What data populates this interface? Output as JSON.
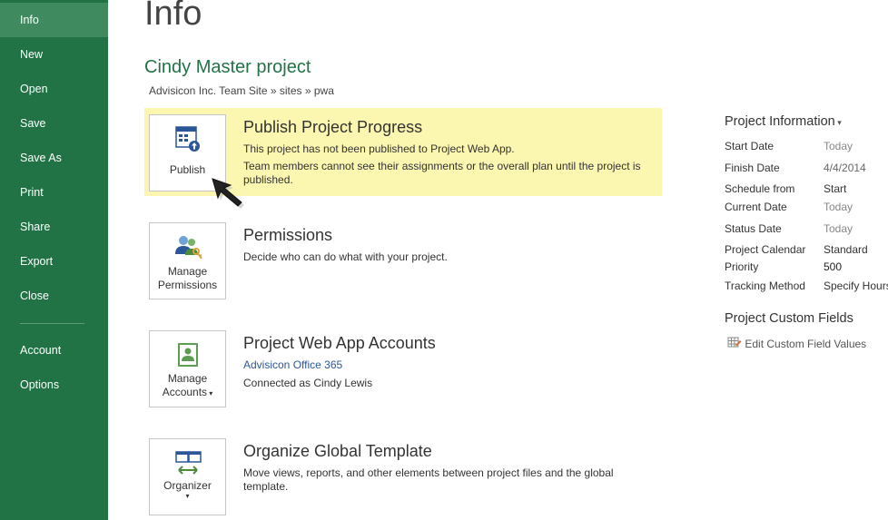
{
  "sidebar": {
    "items": [
      {
        "label": "Info",
        "active": true
      },
      {
        "label": "New"
      },
      {
        "label": "Open"
      },
      {
        "label": "Save"
      },
      {
        "label": "Save As"
      },
      {
        "label": "Print"
      },
      {
        "label": "Share"
      },
      {
        "label": "Export"
      },
      {
        "label": "Close"
      },
      {
        "label": "Account"
      },
      {
        "label": "Options"
      }
    ],
    "bg_color": "#217346"
  },
  "header": {
    "title": "Info",
    "project_name": "Cindy Master project",
    "breadcrumb": "Advisicon Inc. Team Site » sites » pwa"
  },
  "cards": {
    "publish": {
      "tile_label": "Publish",
      "title": "Publish Project Progress",
      "line1": "This project has not been published to Project Web App.",
      "line2": "Team members cannot see their assignments or the overall plan until the project is published.",
      "highlight_color": "#fbf6b0"
    },
    "permissions": {
      "tile_label_1": "Manage",
      "tile_label_2": "Permissions",
      "title": "Permissions",
      "line1": "Decide who can do what with your project."
    },
    "accounts": {
      "tile_label_1": "Manage",
      "tile_label_2": "Accounts",
      "title": "Project Web App Accounts",
      "link": "Advisicon Office 365",
      "line1": "Connected as Cindy Lewis"
    },
    "organizer": {
      "tile_label": "Organizer",
      "title": "Organize Global Template",
      "line1": "Move views, reports, and other elements between project files and the global template."
    }
  },
  "project_info": {
    "header": "Project Information",
    "rows": [
      {
        "label": "Start Date",
        "value": "Today"
      },
      {
        "label": "Finish Date",
        "value": "4/4/2014"
      },
      {
        "label": "Schedule from",
        "value": "Start"
      },
      {
        "label": "Current Date",
        "value": "Today"
      },
      {
        "label": "Status Date",
        "value": "Today"
      },
      {
        "label": "Project Calendar",
        "value": "Standard"
      },
      {
        "label": "Priority",
        "value": "500"
      },
      {
        "label": "Tracking Method",
        "value": "Specify Hours"
      }
    ]
  },
  "custom_fields": {
    "header": "Project Custom Fields",
    "link": "Edit Custom Field Values"
  }
}
